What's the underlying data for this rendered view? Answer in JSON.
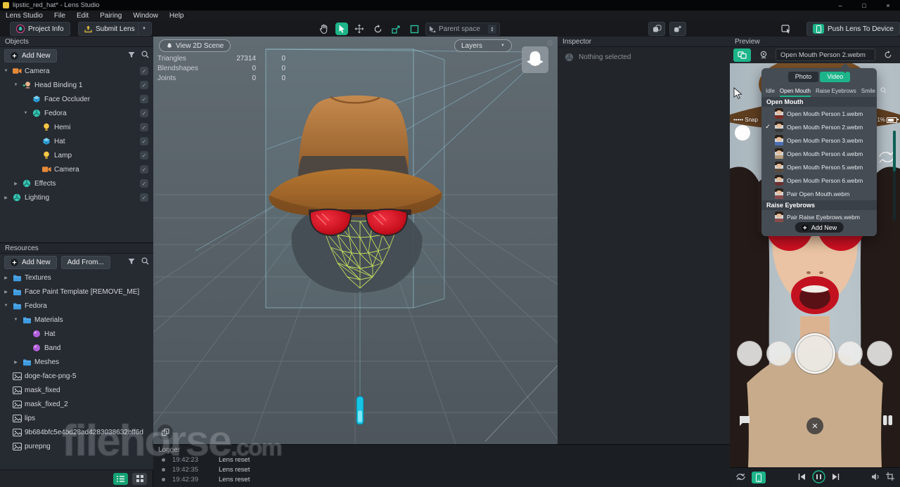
{
  "window": {
    "title": "lipstic_red_hat* - Lens Studio"
  },
  "menu": [
    "Lens Studio",
    "File",
    "Edit",
    "Pairing",
    "Window",
    "Help"
  ],
  "toolbar": {
    "project_info": "Project Info",
    "submit_lens": "Submit Lens",
    "parent_space": "Parent space",
    "push_lens": "Push Lens To Device"
  },
  "objects_panel": {
    "title": "Objects",
    "add_new": "Add New",
    "items": [
      {
        "label": "Camera",
        "depth": 0,
        "icon": "camera-icon",
        "arrow": "expanded"
      },
      {
        "label": "Head Binding 1",
        "depth": 1,
        "icon": "head-icon",
        "arrow": "expanded"
      },
      {
        "label": "Face Occluder",
        "depth": 2,
        "icon": "cube-icon",
        "arrow": "none"
      },
      {
        "label": "Fedora",
        "depth": 2,
        "icon": "mesh-icon",
        "arrow": "expanded"
      },
      {
        "label": "Hemi",
        "depth": 3,
        "icon": "bulb-icon",
        "arrow": "none"
      },
      {
        "label": "Hat",
        "depth": 3,
        "icon": "cube-icon",
        "arrow": "none"
      },
      {
        "label": "Lamp",
        "depth": 3,
        "icon": "bulb-icon",
        "arrow": "none"
      },
      {
        "label": "Camera",
        "depth": 3,
        "icon": "camera-icon",
        "arrow": "none"
      },
      {
        "label": "Effects",
        "depth": 1,
        "icon": "mesh-icon",
        "arrow": "collapsed"
      },
      {
        "label": "Lighting",
        "depth": 0,
        "icon": "mesh-icon",
        "arrow": "collapsed"
      }
    ]
  },
  "resources_panel": {
    "title": "Resources",
    "add_new": "Add New",
    "add_from": "Add From...",
    "items": [
      {
        "label": "Textures",
        "depth": 0,
        "icon": "folder-icon",
        "arrow": "collapsed"
      },
      {
        "label": "Face Paint Template [REMOVE_ME]",
        "depth": 0,
        "icon": "folder-icon",
        "arrow": "collapsed"
      },
      {
        "label": "Fedora",
        "depth": 0,
        "icon": "folder-icon",
        "arrow": "expanded"
      },
      {
        "label": "Materials",
        "depth": 1,
        "icon": "folder-icon",
        "arrow": "expanded"
      },
      {
        "label": "Hat",
        "depth": 2,
        "icon": "material-icon",
        "arrow": "none"
      },
      {
        "label": "Band",
        "depth": 2,
        "icon": "material-icon",
        "arrow": "none"
      },
      {
        "label": "Meshes",
        "depth": 1,
        "icon": "folder-icon",
        "arrow": "collapsed"
      },
      {
        "label": "doge-face-png-5",
        "depth": 0,
        "icon": "image-icon",
        "arrow": "none"
      },
      {
        "label": "mask_fixed",
        "depth": 0,
        "icon": "image-icon",
        "arrow": "none"
      },
      {
        "label": "mask_fixed_2",
        "depth": 0,
        "icon": "image-icon",
        "arrow": "none"
      },
      {
        "label": "lips",
        "depth": 0,
        "icon": "image-icon",
        "arrow": "none"
      },
      {
        "label": "9b684bfc5e4bd28ad4283038632bff6d",
        "depth": 0,
        "icon": "image-icon",
        "arrow": "none"
      },
      {
        "label": "purepng",
        "depth": 0,
        "icon": "image-icon",
        "arrow": "none"
      }
    ]
  },
  "scene": {
    "view_2d": "View 2D Scene",
    "layers": "Layers",
    "stats": [
      {
        "label": "Triangles",
        "v1": "27314",
        "v2": "0"
      },
      {
        "label": "Blendshapes",
        "v1": "0",
        "v2": "0"
      },
      {
        "label": "Joints",
        "v1": "0",
        "v2": "0"
      }
    ]
  },
  "inspector": {
    "title": "Inspector",
    "empty": "Nothing selected"
  },
  "preview": {
    "title": "Preview",
    "source_value": "Open Mouth Person 2.webm",
    "status_left": "••••• Snap",
    "battery": "1%",
    "popup": {
      "mode_tabs": [
        {
          "label": "Photo",
          "active": false
        },
        {
          "label": "Video",
          "active": true
        }
      ],
      "category_tabs": [
        {
          "label": "Idle",
          "active": false
        },
        {
          "label": "Open Mouth",
          "active": true
        },
        {
          "label": "Raise Eyebrows",
          "active": false
        },
        {
          "label": "Smile",
          "active": false
        }
      ],
      "sections": [
        {
          "header": "Open Mouth",
          "items": [
            {
              "label": "Open Mouth Person 1.webm",
              "checked": false,
              "thumb": "#7a2c22"
            },
            {
              "label": "Open Mouth Person 2.webm",
              "checked": true,
              "thumb": "#3a3a3a"
            },
            {
              "label": "Open Mouth Person 3.webm",
              "checked": false,
              "thumb": "#4a6fb5"
            },
            {
              "label": "Open Mouth Person 4.webm",
              "checked": false,
              "thumb": "#b59a7a"
            },
            {
              "label": "Open Mouth Person 5.webm",
              "checked": false,
              "thumb": "#5a4a3a"
            },
            {
              "label": "Open Mouth Person 6.webm",
              "checked": false,
              "thumb": "#6b2f2f"
            },
            {
              "label": "Pair Open Mouth.webm",
              "checked": false,
              "thumb": "#8a4a4a"
            }
          ]
        },
        {
          "header": "Raise Eyebrows",
          "items": [
            {
              "label": "Pair Raise Eyebrows.webm",
              "checked": false,
              "thumb": "#8a4a4a"
            }
          ]
        }
      ],
      "add_new": "Add New"
    }
  },
  "logger": {
    "title": "Logger",
    "entries": [
      {
        "time": "19:42:23",
        "message": "Lens reset"
      },
      {
        "time": "19:42:35",
        "message": "Lens reset"
      },
      {
        "time": "19:42:39",
        "message": "Lens reset"
      }
    ]
  },
  "watermark": {
    "name": "filehorse",
    "tld": ".com"
  },
  "colors": {
    "accent": "#1db489",
    "lens_red": "#c60f1d",
    "mesh_green": "#cbe35f"
  }
}
